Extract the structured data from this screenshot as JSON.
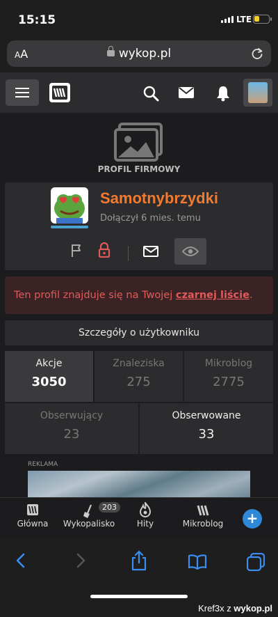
{
  "status_bar": {
    "time": "15:15",
    "network": "LTE",
    "battery_level": 0.35
  },
  "url_bar": {
    "aa": "AA",
    "url": "wykop.pl"
  },
  "header": {
    "icons": [
      "menu-icon",
      "wykop-logo",
      "search-icon",
      "mail-icon",
      "bell-icon",
      "avatar"
    ]
  },
  "profile": {
    "section_title": "PROFIL FIRMOWY",
    "username": "Samotnybrzydki",
    "joined": "Dołączył 6 mies. temu",
    "username_color": "#f07b31"
  },
  "alert": {
    "text_before": "Ten profil znajduje się na Twojej ",
    "link": "czarnej liście",
    "text_after": "."
  },
  "details_button": "Szczegóły o użytkowniku",
  "stats": {
    "akcje": {
      "label": "Akcje",
      "value": "3050"
    },
    "znaleziska": {
      "label": "Znaleziska",
      "value": "275"
    },
    "mikroblog": {
      "label": "Mikroblog",
      "value": "2775"
    },
    "obserwujacy": {
      "label": "Obserwujący",
      "value": "23"
    },
    "obserwowane": {
      "label": "Obserwowane",
      "value": "33"
    }
  },
  "ad": {
    "label": "REKLAMA"
  },
  "bottom_nav": {
    "glowna": "Główna",
    "wykopalisko": "Wykopalisko",
    "wykopalisko_badge": "203",
    "hity": "Hity",
    "mikroblog": "Mikroblog",
    "plus": "+"
  },
  "footer_watermark": {
    "prefix": "Kref3x z ",
    "site": "wykop.pl"
  }
}
